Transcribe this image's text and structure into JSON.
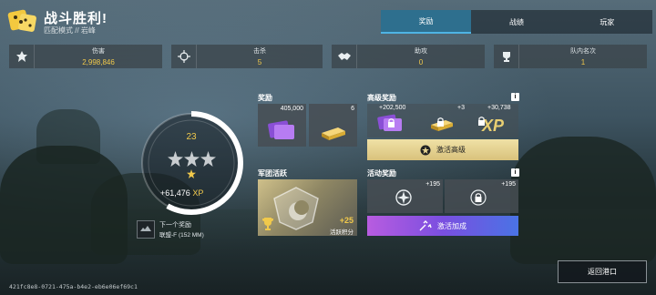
{
  "header": {
    "title": "战斗胜利!",
    "subtitle": "匹配模式 // 岩峰"
  },
  "tabs": [
    {
      "label": "奖励",
      "active": true
    },
    {
      "label": "战绩",
      "active": false
    },
    {
      "label": "玩家",
      "active": false
    }
  ],
  "stats": [
    {
      "label": "伤害",
      "value": "2,998,846",
      "icon": "leaf-burst-icon"
    },
    {
      "label": "击杀",
      "value": "5",
      "icon": "crosshair-icon"
    },
    {
      "label": "助攻",
      "value": "0",
      "icon": "handshake-icon"
    },
    {
      "label": "队内名次",
      "value": "1",
      "icon": "trophy-icon"
    }
  ],
  "progress": {
    "level": "23",
    "stars_filled": 3,
    "bonus_star": 1,
    "xp_gain": "+61,476",
    "xp_unit": "XP",
    "ring_fill": 0.58,
    "next_reward_label": "下一个奖励",
    "next_reward_name": "联盟-F (152 MM)"
  },
  "rewards": {
    "title": "奖励",
    "items": [
      {
        "qty": "405,000",
        "icon": "purple-card-icon"
      },
      {
        "qty": "6",
        "icon": "gold-bar-icon"
      }
    ]
  },
  "premium": {
    "title": "高级奖励",
    "items": [
      {
        "qty": "+202,500",
        "icon": "purple-card-locked-icon"
      },
      {
        "qty": "+3",
        "icon": "gold-bar-locked-icon"
      },
      {
        "qty": "+30,738",
        "icon": "xp-locked-icon",
        "label": "XP"
      }
    ],
    "button": "激活高级"
  },
  "legion": {
    "title": "军团活跃",
    "points": "+25",
    "points_label": "活跃积分"
  },
  "activity": {
    "title": "活动奖励",
    "items": [
      {
        "qty": "+195",
        "icon": "compass-badge-icon"
      },
      {
        "qty": "+195",
        "icon": "locked-icon"
      }
    ],
    "button": "激活加成"
  },
  "footer": {
    "return_label": "返回港口",
    "match_id": "421fc8e8-0721-475a-b4e2-eb6e06ef69c1"
  },
  "colors": {
    "accent_gold": "#f1c94b",
    "tab_active": "#2e6f8e",
    "premium_button": "#e8d592",
    "boost_button_start": "#b85ce0",
    "boost_button_end": "#4a73e5"
  }
}
